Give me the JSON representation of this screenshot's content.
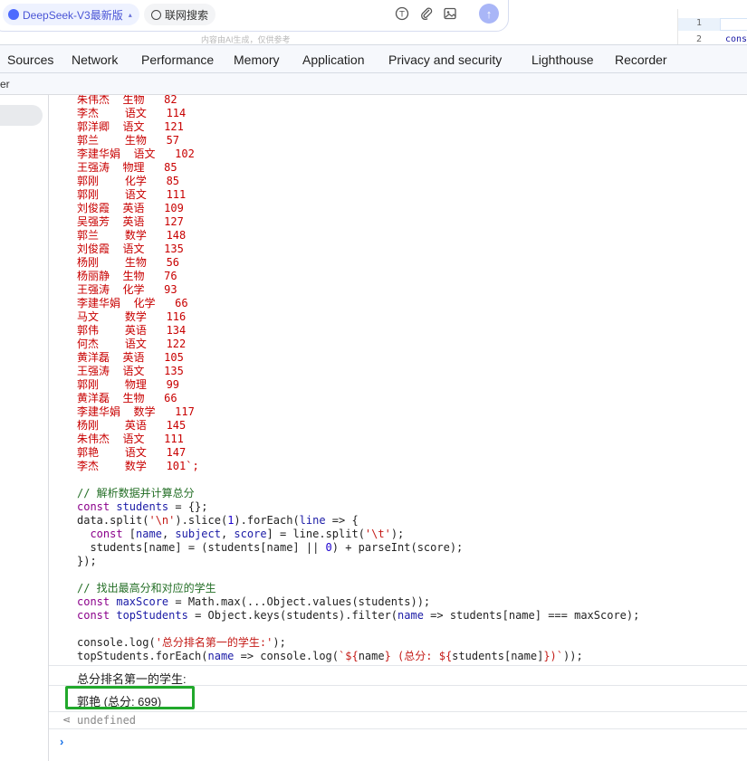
{
  "chat": {
    "model_label": "DeepSeek-V3最新版",
    "web_search_label": "联网搜索",
    "disclaimer": "内容由AI生成，仅供参考",
    "tool_icons": [
      "text-recognition-icon",
      "paperclip-icon",
      "image-icon"
    ]
  },
  "mini_editor": {
    "line1": "1",
    "line2": "2",
    "line2_code": "cons"
  },
  "devtools": {
    "tabs": [
      "Sources",
      "Network",
      "Performance",
      "Memory",
      "Application",
      "Privacy and security",
      "Lighthouse",
      "Recorder"
    ],
    "filter_text": "er"
  },
  "console": {
    "data_rows": [
      [
        "朱伟杰",
        "生物",
        "82"
      ],
      [
        "李杰",
        "语文",
        "114"
      ],
      [
        "郭洋卿",
        "语文",
        "121"
      ],
      [
        "郭兰",
        "生物",
        "57"
      ],
      [
        "李建华娟",
        "语文",
        "102"
      ],
      [
        "王强涛",
        "物理",
        "85"
      ],
      [
        "郭刚",
        "化学",
        "85"
      ],
      [
        "郭刚",
        "语文",
        "111"
      ],
      [
        "刘俊霞",
        "英语",
        "109"
      ],
      [
        "吴强芳",
        "英语",
        "127"
      ],
      [
        "郭兰",
        "数学",
        "148"
      ],
      [
        "刘俊霞",
        "语文",
        "135"
      ],
      [
        "杨刚",
        "生物",
        "56"
      ],
      [
        "杨丽静",
        "生物",
        "76"
      ],
      [
        "王强涛",
        "化学",
        "93"
      ],
      [
        "李建华娟",
        "化学",
        "66"
      ],
      [
        "马文",
        "数学",
        "116"
      ],
      [
        "郭伟",
        "英语",
        "134"
      ],
      [
        "何杰",
        "语文",
        "122"
      ],
      [
        "黄洋磊",
        "英语",
        "105"
      ],
      [
        "王强涛",
        "语文",
        "135"
      ],
      [
        "郭刚",
        "物理",
        "99"
      ],
      [
        "黄洋磊",
        "生物",
        "66"
      ],
      [
        "李建华娟",
        "数学",
        "117"
      ],
      [
        "杨刚",
        "英语",
        "145"
      ],
      [
        "朱伟杰",
        "语文",
        "111"
      ],
      [
        "郭艳",
        "语文",
        "147"
      ],
      [
        "李杰",
        "数学",
        "101`;"
      ]
    ],
    "code": {
      "comment1": "// 解析数据并计算总分",
      "line_students": "const students = {};",
      "line_split": "data.split('\\n').slice(1).forEach(line => {",
      "line_destructure": "  const [name, subject, score] = line.split('\\t');",
      "line_accumulate": "  students[name] = (students[name] || 0) + parseInt(score);",
      "line_close": "});",
      "comment2": "// 找出最高分和对应的学生",
      "line_max": "const maxScore = Math.max(...Object.values(students));",
      "line_top": "const topStudents = Object.keys(students).filter(name => students[name] === maxScore);",
      "line_log1": "console.log('总分排名第一的学生:');",
      "line_log2": "topStudents.forEach(name => console.log(`${name} (总分: ${students[name]})`));"
    },
    "output_line1": "总分排名第一的学生:",
    "output_line2": "郭艳 (总分: 699)",
    "undefined_text": "undefined",
    "highlight_color": "#21a82b"
  }
}
